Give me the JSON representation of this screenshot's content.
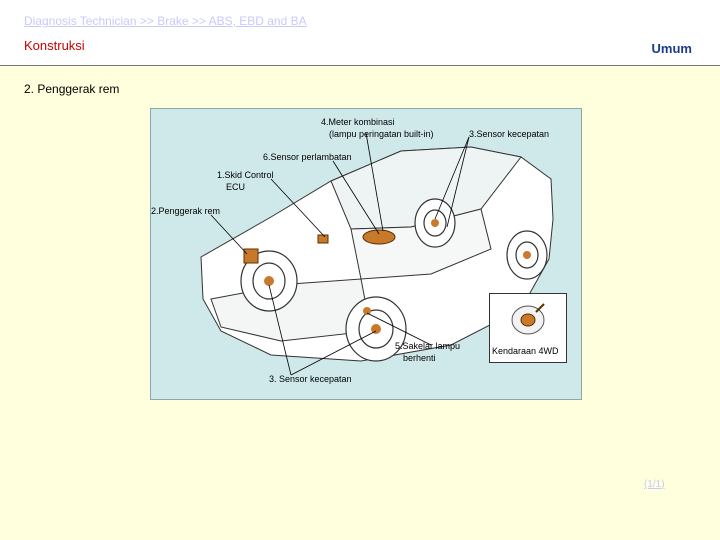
{
  "header": {
    "breadcrumb": "Diagnosis Technician >> Brake  >> ABS, EBD and BA",
    "section_title": "Konstruksi",
    "scope_label": "Umum"
  },
  "topic": "2. Penggerak rem",
  "diagram": {
    "labels": {
      "meter_line1": "4.Meter kombinasi",
      "meter_line2": "(lampu peringatan built-in)",
      "speed_sensor_rear": "3.Sensor kecepatan",
      "decel_sensor": "6.Sensor perlambatan",
      "ecu_line1": "1.Skid Control",
      "ecu_line2": "ECU",
      "actuator": "2.Penggerak rem",
      "stop_switch_line1": "5.Sakelar lampu",
      "stop_switch_line2": "berhenti",
      "speed_sensor_front": "3. Sensor kecepatan",
      "inset_caption": "Kendaraan 4WD"
    }
  },
  "pager": "(1/1)",
  "colors": {
    "page_bg": "#ffffdd",
    "figure_bg": "#cfe8ea",
    "title_red": "#cc0000",
    "scope_blue": "#1a3a8a",
    "link": "#c8c8ff",
    "component_orange": "#c87a2a"
  }
}
